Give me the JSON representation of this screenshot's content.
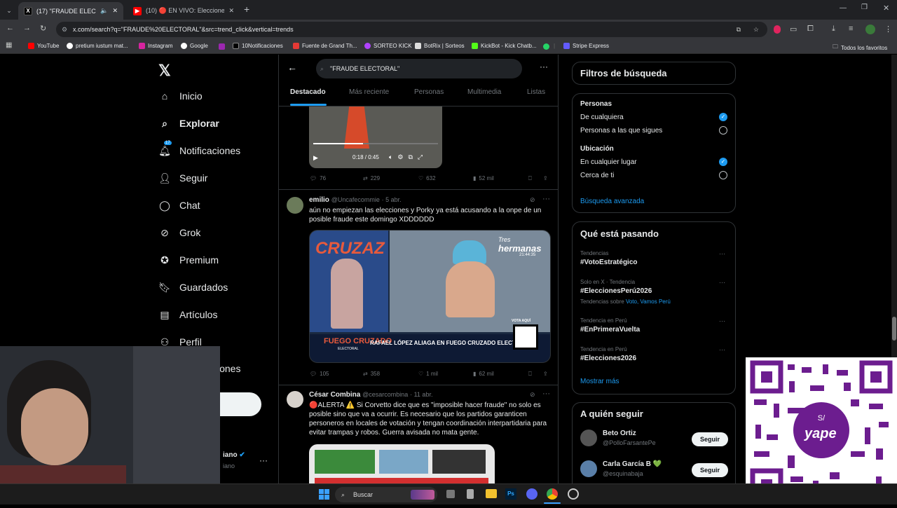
{
  "browser": {
    "tabs": [
      {
        "title": "(17) \"FRAUDE ELECTORAL\""
      },
      {
        "title": "(10) 🔴 EN VIVO: Elecciones Ge"
      }
    ],
    "url": "x.com/search?q=\"FRAUDE%20ELECTORAL\"&src=trend_click&vertical=trends",
    "bookmarks": [
      "YouTube",
      "pretium iustum mat...",
      "Instagram",
      "Google",
      "10Notificaciones",
      "Fuente de Grand Th...",
      "SORTEO KICK",
      "BotRix | Sorteos",
      "KickBot - Kick Chatb...",
      "Stripe Express"
    ],
    "all_bookmarks": "Todos los favoritos"
  },
  "sidebar": {
    "items": [
      {
        "label": "Inicio",
        "icon": "home-icon"
      },
      {
        "label": "Explorar",
        "icon": "search-icon"
      },
      {
        "label": "Notificaciones",
        "icon": "bell-icon",
        "badge": "17"
      },
      {
        "label": "Seguir",
        "icon": "add-person-icon"
      },
      {
        "label": "Chat",
        "icon": "chat-icon"
      },
      {
        "label": "Grok",
        "icon": "grok-icon"
      },
      {
        "label": "Premium",
        "icon": "verified-icon"
      },
      {
        "label": "Guardados",
        "icon": "bookmark-icon"
      },
      {
        "label": "Artículos",
        "icon": "article-icon"
      },
      {
        "label": "Perfil",
        "icon": "person-icon"
      }
    ],
    "more_partial": "ciones",
    "account_partial": "iano",
    "account_handle_partial": "iano"
  },
  "search": {
    "query": "\"FRAUDE ELECTORAL\"",
    "tabs": [
      "Destacado",
      "Más reciente",
      "Personas",
      "Multimedia",
      "Listas"
    ]
  },
  "video": {
    "time": "0:18 / 0:45"
  },
  "posts": [
    {
      "replies": "76",
      "reposts": "229",
      "likes": "632",
      "views": "52 mil"
    },
    {
      "name": "emilio",
      "handle": "@Uncafecommie",
      "date": "· 5 abr.",
      "text": "aún no empiezan las elecciones y Porky ya está acusando a la onpe de un posible fraude este domingo XDDDDDD",
      "image": {
        "brand": "CRUZAZ",
        "brand_top": "Tres",
        "brand_show": "hermanas",
        "clock": "21:44:35",
        "show": "FUEGO CRUZADO",
        "show_sub": "ELECTORAL",
        "caption": "RAFAEL LÓPEZ ALIAGA EN FUEGO CRUZADO ELECTORAL",
        "qr_label": "VOTA AQUÍ"
      },
      "replies": "105",
      "reposts": "358",
      "likes": "1 mil",
      "views": "62 mil"
    },
    {
      "name": "César Combina",
      "handle": "@cesarcombina",
      "date": "· 11 abr.",
      "text": "🔴ALERTA ⚠️ Si Corvetto dice que es \"imposible hacer fraude\" no solo es posible sino que va a ocurrir. Es necesario que los partidos garanticen personeros en locales de votación y tengan coordinación interpartidaria para evitar trampas y robos. Guerra avisada no mata gente."
    }
  ],
  "filters": {
    "title": "Filtros de búsqueda",
    "people_heading": "Personas",
    "people_options": [
      "De cualquiera",
      "Personas a las que sigues"
    ],
    "location_heading": "Ubicación",
    "location_options": [
      "En cualquier lugar",
      "Cerca de ti"
    ],
    "advanced": "Búsqueda avanzada"
  },
  "trends": {
    "title": "Qué está pasando",
    "items": [
      {
        "context": "Tendencias",
        "name": "#VotoEstratégico",
        "extra": ""
      },
      {
        "context": "Solo en X · Tendencia",
        "name": "#EleccionesPerú2026",
        "extra_prefix": "Tendencias sobre",
        "extra_links": "Voto, Vamos Perú"
      },
      {
        "context": "Tendencia en Perú",
        "name": "#EnPrimeraVuelta",
        "extra": ""
      },
      {
        "context": "Tendencia en Perú",
        "name": "#Elecciones2026",
        "extra": ""
      }
    ],
    "more": "Mostrar más"
  },
  "who_to_follow": {
    "title": "A quién seguir",
    "users": [
      {
        "name": "Beto Ortiz",
        "handle": "@PolloFarsantePe",
        "button": "Seguir"
      },
      {
        "name": "Carla García B 💚",
        "handle": "@esquinabaja",
        "button": "Seguir"
      }
    ]
  },
  "overlay": {
    "qr_brand": "yape"
  },
  "taskbar": {
    "search_placeholder": "Buscar"
  },
  "colors": {
    "accent": "#1d9bf0",
    "bg": "#000000",
    "text": "#e7e9ea",
    "muted": "#71767b",
    "yape": "#6c1d8f"
  }
}
